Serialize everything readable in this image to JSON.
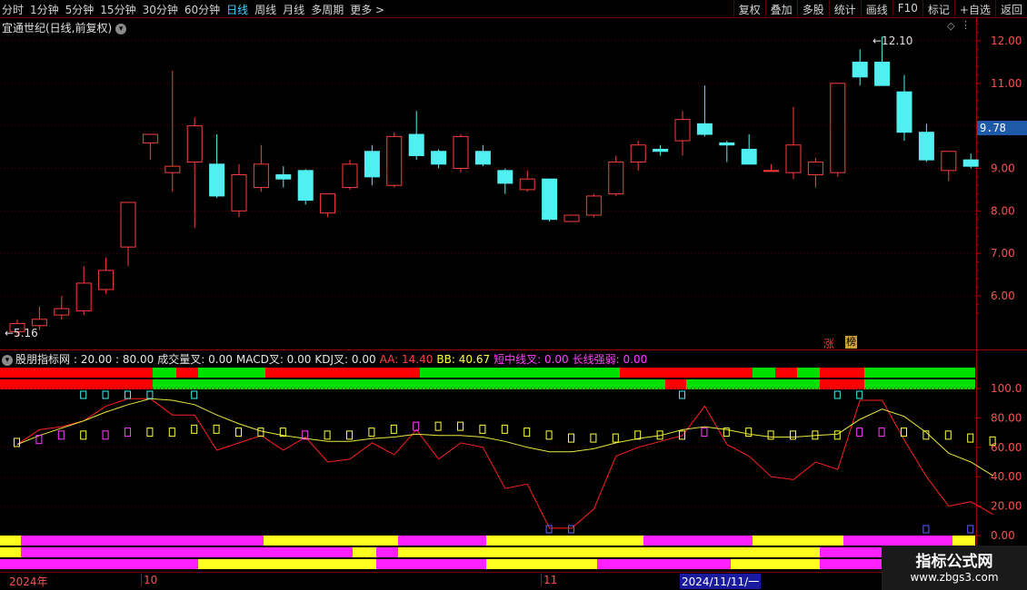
{
  "toolbar": {
    "periods": [
      "分时",
      "1分钟",
      "5分钟",
      "15分钟",
      "30分钟",
      "60分钟",
      "日线",
      "周线",
      "月线",
      "多周期",
      "更多 >"
    ],
    "active_period": "日线",
    "actions": [
      "复权",
      "叠加",
      "多股",
      "统计",
      "画线",
      "F10",
      "标记",
      "+自选",
      "返回"
    ]
  },
  "price_pane": {
    "title": "宜通世纪(日线,前复权)",
    "high_label": "12.10",
    "low_label": "5.16",
    "current_price": "9.78",
    "tag_zhang": "涨",
    "tag_bang": "榜",
    "y_ticks": [
      "12.00",
      "11.00",
      "10.00",
      "9.00",
      "8.00",
      "7.00",
      "6.00"
    ]
  },
  "indicator_pane": {
    "name": "股朋指标网",
    "params": ": 20.00 : 80.00",
    "items": [
      {
        "label": "成交量叉: 0.00",
        "color": "#e6e6e6"
      },
      {
        "label": "MACD叉: 0.00",
        "color": "#e6e6e6"
      },
      {
        "label": "KDJ叉: 0.00",
        "color": "#e6e6e6"
      },
      {
        "label": "AA: 14.40",
        "color": "#ff4040"
      },
      {
        "label": "BB: 40.67",
        "color": "#ffff40"
      },
      {
        "label": "短中线叉: 0.00",
        "color": "#ff40ff"
      },
      {
        "label": "长线强弱: 0.00",
        "color": "#ff40ff"
      }
    ],
    "y_ticks": [
      "100.0",
      "80.00",
      "60.00",
      "40.00",
      "20.00",
      "0.00"
    ]
  },
  "date_axis": {
    "year_label": "2024年",
    "month_10": "10",
    "month_11": "11",
    "cursor_date": "2024/11/11/一"
  },
  "watermark": {
    "line1": "指标公式网",
    "line2": "www.zbgs3.com"
  },
  "chart_data": {
    "type": "candlestick",
    "candles": [
      {
        "o": 5.16,
        "h": 5.45,
        "l": 5.05,
        "c": 5.35
      },
      {
        "o": 5.3,
        "h": 5.75,
        "l": 5.2,
        "c": 5.45
      },
      {
        "o": 5.55,
        "h": 6.0,
        "l": 5.45,
        "c": 5.7
      },
      {
        "o": 5.65,
        "h": 6.7,
        "l": 5.55,
        "c": 6.3
      },
      {
        "o": 6.15,
        "h": 6.9,
        "l": 6.05,
        "c": 6.6
      },
      {
        "o": 7.15,
        "h": 8.2,
        "l": 6.7,
        "c": 8.2
      },
      {
        "o": 9.6,
        "h": 9.75,
        "l": 9.2,
        "c": 9.8
      },
      {
        "o": 8.9,
        "h": 11.3,
        "l": 8.45,
        "c": 9.05
      },
      {
        "o": 9.15,
        "h": 10.2,
        "l": 7.6,
        "c": 10.0
      },
      {
        "o": 9.1,
        "h": 9.8,
        "l": 8.3,
        "c": 8.35
      },
      {
        "o": 8.0,
        "h": 9.1,
        "l": 7.85,
        "c": 8.85
      },
      {
        "o": 8.55,
        "h": 9.55,
        "l": 8.45,
        "c": 9.1
      },
      {
        "o": 8.85,
        "h": 9.05,
        "l": 8.55,
        "c": 8.75
      },
      {
        "o": 8.95,
        "h": 8.98,
        "l": 8.15,
        "c": 8.25
      },
      {
        "o": 7.95,
        "h": 8.35,
        "l": 7.85,
        "c": 8.4
      },
      {
        "o": 8.55,
        "h": 9.2,
        "l": 8.5,
        "c": 9.1
      },
      {
        "o": 9.4,
        "h": 9.55,
        "l": 8.6,
        "c": 8.8
      },
      {
        "o": 8.6,
        "h": 9.85,
        "l": 8.55,
        "c": 9.75
      },
      {
        "o": 9.8,
        "h": 10.35,
        "l": 9.2,
        "c": 9.3
      },
      {
        "o": 9.4,
        "h": 9.45,
        "l": 9.0,
        "c": 9.1
      },
      {
        "o": 9.0,
        "h": 9.8,
        "l": 8.9,
        "c": 9.75
      },
      {
        "o": 9.4,
        "h": 9.55,
        "l": 9.05,
        "c": 9.1
      },
      {
        "o": 8.95,
        "h": 9.0,
        "l": 8.4,
        "c": 8.65
      },
      {
        "o": 8.5,
        "h": 8.95,
        "l": 8.45,
        "c": 8.75
      },
      {
        "o": 8.75,
        "h": 8.75,
        "l": 7.75,
        "c": 7.8
      },
      {
        "o": 7.75,
        "h": 7.9,
        "l": 7.75,
        "c": 7.9
      },
      {
        "o": 7.9,
        "h": 8.4,
        "l": 7.85,
        "c": 8.35
      },
      {
        "o": 8.4,
        "h": 9.3,
        "l": 8.35,
        "c": 9.15
      },
      {
        "o": 9.15,
        "h": 9.65,
        "l": 8.95,
        "c": 9.55
      },
      {
        "o": 9.45,
        "h": 9.55,
        "l": 9.3,
        "c": 9.4
      },
      {
        "o": 9.65,
        "h": 10.35,
        "l": 9.3,
        "c": 10.15
      },
      {
        "o": 10.05,
        "h": 10.95,
        "l": 9.75,
        "c": 9.8
      },
      {
        "o": 9.6,
        "h": 9.65,
        "l": 9.15,
        "c": 9.55
      },
      {
        "o": 9.45,
        "h": 9.8,
        "l": 9.1,
        "c": 9.1
      },
      {
        "o": 8.95,
        "h": 9.1,
        "l": 8.95,
        "c": 8.95
      },
      {
        "o": 8.9,
        "h": 10.45,
        "l": 8.75,
        "c": 9.55
      },
      {
        "o": 8.85,
        "h": 9.25,
        "l": 8.55,
        "c": 9.15
      },
      {
        "o": 8.9,
        "h": 11.0,
        "l": 8.8,
        "c": 11.0
      },
      {
        "o": 11.5,
        "h": 11.8,
        "l": 10.95,
        "c": 11.15
      },
      {
        "o": 11.5,
        "h": 12.1,
        "l": 10.95,
        "c": 10.95
      },
      {
        "o": 10.8,
        "h": 11.2,
        "l": 9.65,
        "c": 9.85
      },
      {
        "o": 9.85,
        "h": 10.05,
        "l": 9.15,
        "c": 9.2
      },
      {
        "o": 8.95,
        "h": 9.4,
        "l": 8.7,
        "c": 9.4
      },
      {
        "o": 9.2,
        "h": 9.35,
        "l": 9.0,
        "c": 9.05
      }
    ],
    "aa_line": [
      62,
      72,
      74,
      78,
      88,
      93,
      93,
      82,
      82,
      58,
      63,
      68,
      58,
      67,
      50,
      52,
      63,
      55,
      72,
      52,
      63,
      60,
      32,
      35,
      5,
      5,
      18,
      54,
      60,
      64,
      68,
      88,
      62,
      54,
      40,
      38,
      50,
      45,
      92,
      92,
      65,
      40,
      20,
      23,
      14.4
    ],
    "bb_line": [
      62,
      68,
      73,
      78,
      84,
      89,
      93,
      92,
      89,
      82,
      76,
      71,
      68,
      66,
      64,
      64,
      66,
      67,
      69,
      68,
      68,
      67,
      64,
      60,
      57,
      57,
      59,
      63,
      66,
      68,
      72,
      74,
      72,
      69,
      67,
      67,
      68,
      69,
      79,
      86,
      81,
      70,
      56,
      50,
      40.67
    ],
    "marker_values": [
      63,
      65,
      68,
      68,
      68,
      70,
      70,
      70,
      72,
      72,
      70,
      70,
      70,
      68,
      68,
      68,
      70,
      72,
      74,
      74,
      74,
      72,
      72,
      70,
      68,
      66,
      66,
      66,
      68,
      68,
      68,
      70,
      70,
      70,
      68,
      68,
      68,
      68,
      70,
      70,
      70,
      68,
      68,
      66,
      64
    ]
  }
}
